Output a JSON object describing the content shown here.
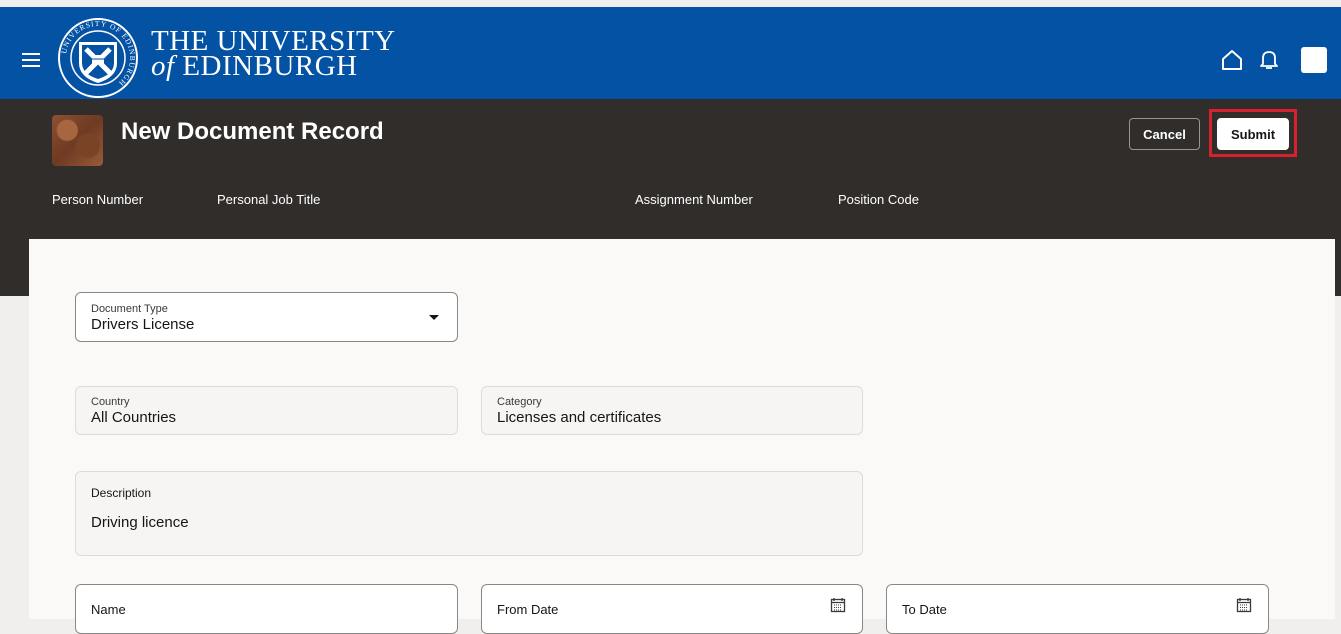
{
  "app": {
    "name_line1": "THE UNIVERSITY",
    "name_of": "of",
    "name_line2": "EDINBURGH",
    "crest_text": "UNIVERSITY OF EDINBURGH"
  },
  "header": {
    "title": "New Document Record",
    "cancel_label": "Cancel",
    "submit_label": "Submit",
    "meta": [
      "Person Number",
      "Personal Job Title",
      "Assignment Number",
      "Position Code"
    ]
  },
  "form": {
    "document_type": {
      "label": "Document Type",
      "value": "Drivers License"
    },
    "country": {
      "label": "Country",
      "value": "All Countries"
    },
    "category": {
      "label": "Category",
      "value": "Licenses and certificates"
    },
    "description": {
      "label": "Description",
      "value": "Driving licence"
    },
    "name": {
      "label": "Name",
      "value": ""
    },
    "from_date": {
      "label": "From Date",
      "value": ""
    },
    "to_date": {
      "label": "To Date",
      "value": ""
    }
  },
  "colors": {
    "brand_blue": "#0352a3",
    "header_dark": "#312d2a",
    "highlight_red": "#d6212f"
  }
}
